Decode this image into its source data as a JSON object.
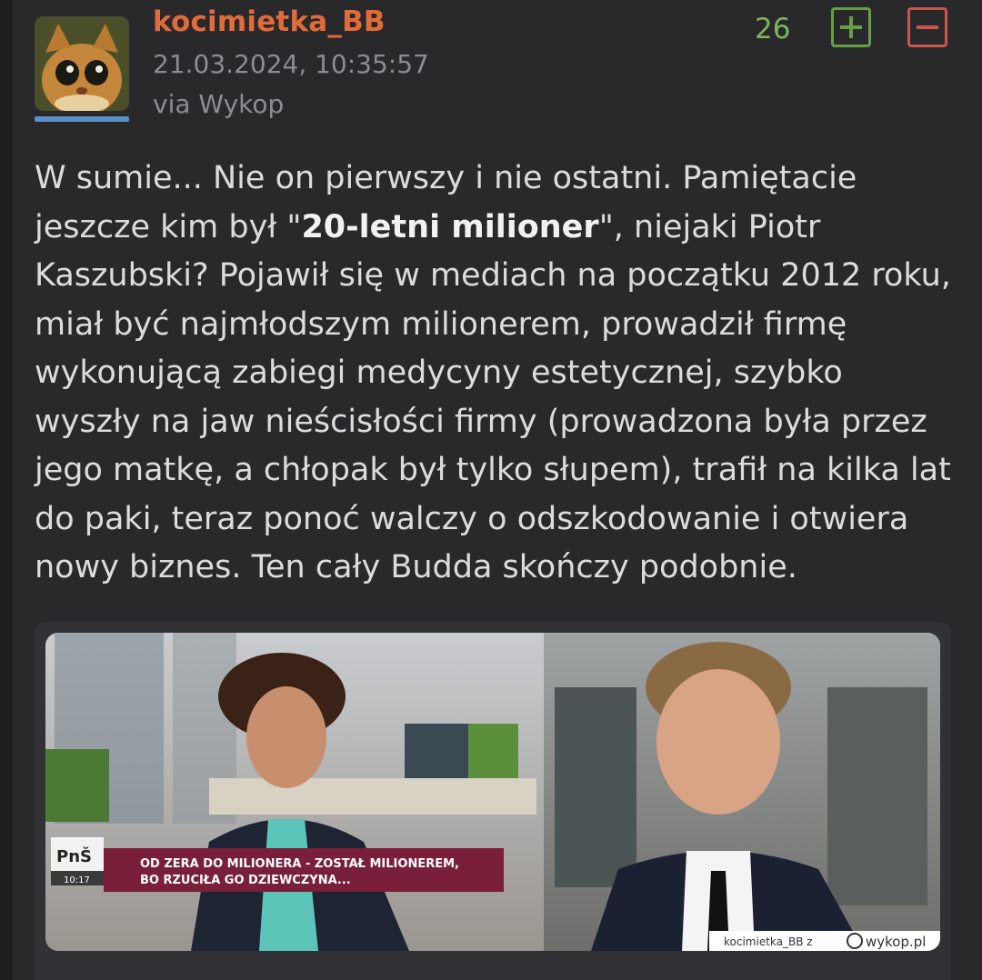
{
  "post": {
    "author": "kocimietka_BB",
    "date": "21.03.2024, 10:35:57",
    "via": "via Wykop",
    "score": "26",
    "plus_label": "+",
    "minus_label": "−",
    "text": {
      "part1": "W sumie... Nie on pierwszy i nie ostatni. Pamiętacie jeszcze kim był \"",
      "bold": "20-letni milioner",
      "part2": "\", niejaki Piotr Kaszubski? Pojawił się w mediach na początku 2012 roku, miał być najmłodszym milionerem, prowadził firmę wykonującą zabiegi medycyny estetycznej, szybko wyszły na jaw nieścisłości firmy (prowadzona była przez jego matkę, a chłopak był tylko słupem), trafił na kilka lat do paki, teraz ponoć walczy o odszkodowanie i otwiera nowy biznes. Ten cały Budda skończy podobnie."
    }
  },
  "media": {
    "tv_logo": "PnŠ",
    "tv_time": "10:17",
    "caption_line1": "OD ZERA DO MILIONERA - ZOSTAŁ MILIONEREM,",
    "caption_line2": "BO RZUCIŁA GO DZIEWCZYNA...",
    "watermark_user": "kocimietka_BB z",
    "watermark_site": "wykop.pl"
  },
  "colors": {
    "background": "#1e1e21",
    "card": "#29292c",
    "author": "#e26b3a",
    "score": "#7fb35d",
    "plus": "#64a044",
    "minus": "#c8564d",
    "avatar_underline": "#5a92c8"
  },
  "icons": [
    "cat-avatar",
    "plus-icon",
    "minus-icon",
    "wykop-logo-icon"
  ]
}
